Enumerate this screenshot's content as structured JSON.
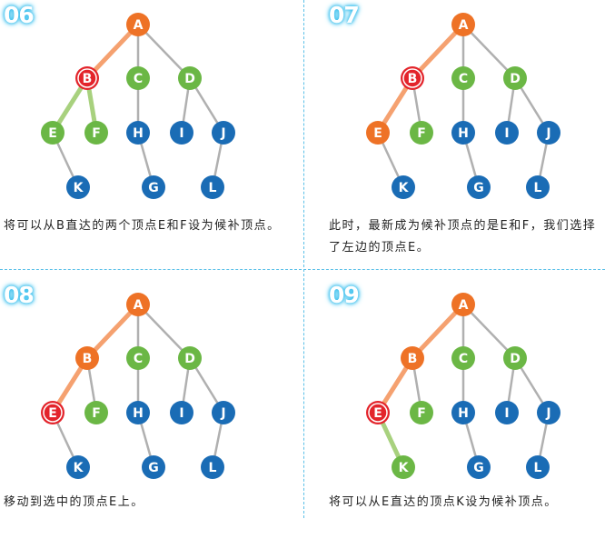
{
  "colors": {
    "orange": "#ee7226",
    "green": "#6bb745",
    "blue": "#1a6cb5",
    "red": "#e3242b",
    "edge_gray": "#b0b0b0",
    "path_orange": "#f5a170",
    "path_green": "#a8d17e"
  },
  "nodes": [
    "A",
    "B",
    "C",
    "D",
    "E",
    "F",
    "H",
    "I",
    "J",
    "K",
    "G",
    "L"
  ],
  "edges": [
    [
      "A",
      "B"
    ],
    [
      "A",
      "C"
    ],
    [
      "A",
      "D"
    ],
    [
      "B",
      "E"
    ],
    [
      "B",
      "F"
    ],
    [
      "C",
      "H"
    ],
    [
      "D",
      "I"
    ],
    [
      "D",
      "J"
    ],
    [
      "E",
      "K"
    ],
    [
      "H",
      "G"
    ],
    [
      "J",
      "L"
    ]
  ],
  "panels": [
    {
      "step": "06",
      "caption": "将可以从B直达的两个顶点E和F设为候补顶点。",
      "node_states": {
        "A": "orange",
        "B": "current",
        "C": "green",
        "D": "green",
        "E": "green",
        "F": "green",
        "H": "blue",
        "I": "blue",
        "J": "blue",
        "K": "blue",
        "G": "blue",
        "L": "blue"
      },
      "edge_states": {
        "A-B": "path_orange",
        "B-E": "path_green",
        "B-F": "path_green"
      }
    },
    {
      "step": "07",
      "caption": "此时，最新成为候补顶点的是E和F，我们选择了左边的顶点E。",
      "node_states": {
        "A": "orange",
        "B": "current",
        "C": "green",
        "D": "green",
        "E": "orange",
        "F": "green",
        "H": "blue",
        "I": "blue",
        "J": "blue",
        "K": "blue",
        "G": "blue",
        "L": "blue"
      },
      "edge_states": {
        "A-B": "path_orange",
        "B-E": "path_orange"
      }
    },
    {
      "step": "08",
      "caption": "移动到选中的顶点E上。",
      "node_states": {
        "A": "orange",
        "B": "orange",
        "C": "green",
        "D": "green",
        "E": "current",
        "F": "green",
        "H": "blue",
        "I": "blue",
        "J": "blue",
        "K": "blue",
        "G": "blue",
        "L": "blue"
      },
      "edge_states": {
        "A-B": "path_orange",
        "B-E": "path_orange"
      }
    },
    {
      "step": "09",
      "caption": "将可以从E直达的顶点K设为候补顶点。",
      "node_states": {
        "A": "orange",
        "B": "orange",
        "C": "green",
        "D": "green",
        "E": "current",
        "F": "green",
        "H": "blue",
        "I": "blue",
        "J": "blue",
        "K": "green",
        "G": "blue",
        "L": "blue"
      },
      "edge_states": {
        "A-B": "path_orange",
        "B-E": "path_orange",
        "E-K": "path_green"
      }
    }
  ]
}
